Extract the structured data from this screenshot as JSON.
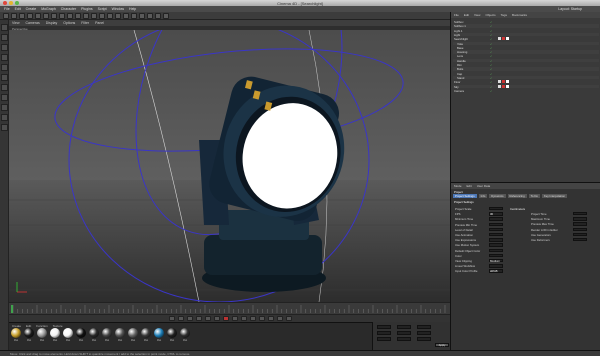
{
  "window": {
    "title": "Cinema 4D - [Searchlight]",
    "layout_label": "Layout: Startup"
  },
  "menubar": [
    "File",
    "Edit",
    "Create",
    "MoGraph",
    "Character",
    "Plugins",
    "Script",
    "Window",
    "Help"
  ],
  "viewport": {
    "menu": [
      "View",
      "Cameras",
      "Display",
      "Options",
      "Filter",
      "Panel"
    ],
    "tab": "Perspective"
  },
  "object_manager": {
    "menu": [
      "File",
      "Edit",
      "View",
      "Objects",
      "Tags",
      "Bookmarks"
    ],
    "rows": [
      {
        "name": "Softbox",
        "tags": ""
      },
      {
        "name": "Softbox.1",
        "tags": ""
      },
      {
        "name": "Light.1",
        "tags": ""
      },
      {
        "name": "Light",
        "tags": ""
      },
      {
        "name": "Searchlight",
        "tags": ""
      },
      {
        "name": "Yoke",
        "tags": ""
      },
      {
        "name": "Base",
        "tags": ""
      },
      {
        "name": "Housing",
        "tags": ""
      },
      {
        "name": "Lens",
        "tags": ""
      },
      {
        "name": "Handle",
        "tags": ""
      },
      {
        "name": "Rim",
        "tags": ""
      },
      {
        "name": "Bolts",
        "tags": ""
      },
      {
        "name": "Cap",
        "tags": ""
      },
      {
        "name": "Stand",
        "tags": ""
      },
      {
        "name": "Floor",
        "tags": ""
      },
      {
        "name": "Sky",
        "tags": ""
      },
      {
        "name": "Camera",
        "tags": ""
      }
    ]
  },
  "attribute_manager": {
    "menu": [
      "Mode",
      "Edit",
      "User Data"
    ],
    "object_label": "Project",
    "tabs": [
      "Project Settings",
      "Info",
      "Dynamics",
      "Referencing",
      "To Do",
      "Key Interpolation"
    ],
    "section": "Project Settings",
    "left_fields": [
      "Project Scale",
      "FPS",
      "Minimum Time",
      "Preview Min Time",
      "Level of Detail",
      "Use Animation",
      "Use Expressions",
      "Use Motion System",
      "Default Object Color",
      "Color",
      "View Clipping",
      "Linear Workflow",
      "Input Color Profile"
    ],
    "right_fields": [
      "Project Time",
      "Maximum Time",
      "Preview Max Time",
      "Render LOD in Editor",
      "Use Generators",
      "Use Deformers"
    ],
    "scale_unit": "Centimeters",
    "fps_value": "30",
    "view_clipping": "Medium",
    "color_profile": "sRGB"
  },
  "materials": {
    "menu": [
      "Create",
      "Edit",
      "Function",
      "Texture"
    ],
    "items": [
      {
        "label": "Mat",
        "color": "#c9a12c"
      },
      {
        "label": "Mat",
        "color": "#1a1a1a"
      },
      {
        "label": "Mat",
        "color": "#9a9a9a"
      },
      {
        "label": "Mat",
        "color": "#f2f2f2"
      },
      {
        "label": "Mat",
        "color": "#f7f7f7"
      },
      {
        "label": "Mat",
        "color": "#111111"
      },
      {
        "label": "Mat",
        "color": "#2a2a2a"
      },
      {
        "label": "Mat",
        "color": "#444444"
      },
      {
        "label": "Mat",
        "color": "#555555"
      },
      {
        "label": "Mat",
        "color": "#666666"
      },
      {
        "label": "Mat",
        "color": "#3a3a3a"
      },
      {
        "label": "Mat",
        "color": "#1d7fb8"
      },
      {
        "label": "Mat",
        "color": "#202020"
      },
      {
        "label": "Mat",
        "color": "#2f2f2f"
      }
    ]
  },
  "coords": {
    "apply_label": "Apply"
  },
  "status": "Move: Click and drag to move elements. Hold down SHIFT to quantize movement / add to the selection in point mode, CTRL to remove.",
  "colors": {
    "accent": "#4c77b6",
    "viewport_bg": "#4a4a4a",
    "orbit": "#3a35c8",
    "lens": "#ffffff"
  }
}
